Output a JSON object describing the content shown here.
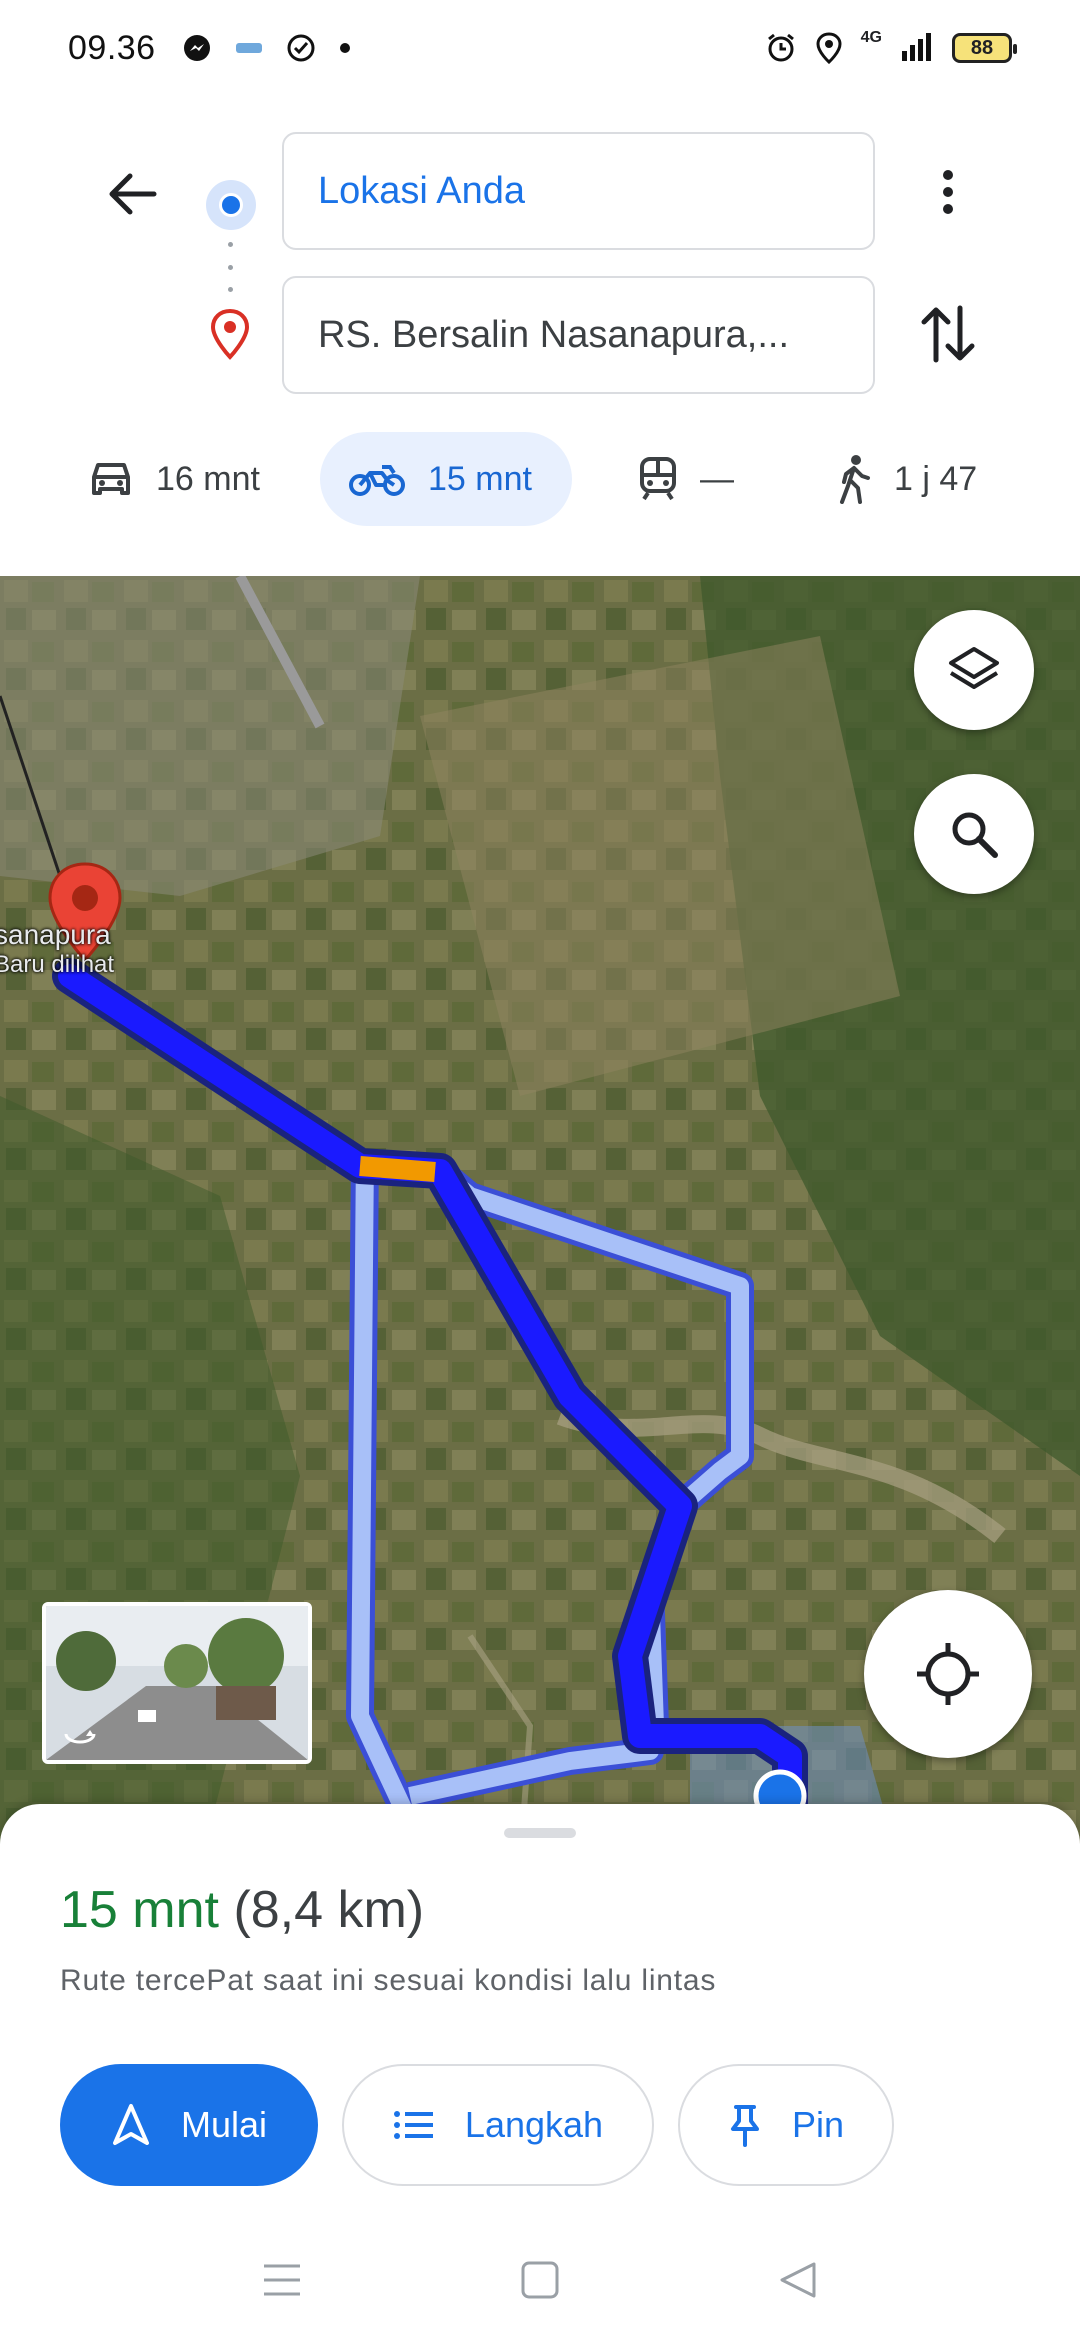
{
  "status_bar": {
    "time": "09.36",
    "network": "4G",
    "battery": "88"
  },
  "header": {
    "origin": "Lokasi Anda",
    "destination": "RS. Bersalin Nasanapura,..."
  },
  "modes": [
    {
      "name": "car",
      "label": "16 mnt",
      "icon": "car-icon"
    },
    {
      "name": "motorcycle",
      "label": "15 mnt",
      "icon": "motorcycle-icon",
      "selected": true
    },
    {
      "name": "transit",
      "label": "—",
      "icon": "train-icon"
    },
    {
      "name": "walk",
      "label": "1 j 47",
      "icon": "walking-icon"
    }
  ],
  "map": {
    "place_label": "sanapura",
    "place_sublabel": "Baru dilihat",
    "route_color": "#1a1aff",
    "alt_route_color": "#a8c0f8",
    "traffic_color": "#f29900"
  },
  "sheet": {
    "duration": "15 mnt",
    "distance": "(8,4 km)",
    "note": "Rute tercePat saat ini sesuai kondisi lalu lintas",
    "start_label": "Mulai",
    "steps_label": "Langkah",
    "pin_label": "Pin"
  }
}
